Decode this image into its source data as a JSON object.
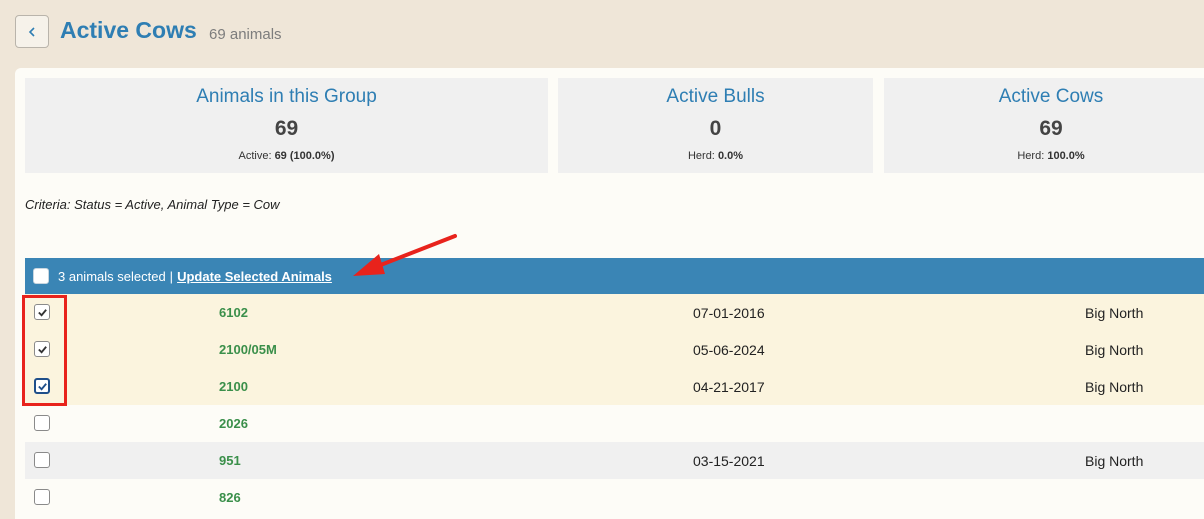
{
  "header": {
    "title": "Active Cows",
    "count": "69 animals"
  },
  "stats": [
    {
      "title": "Animals in this Group",
      "value": "69",
      "sub_label": "Active:",
      "sub_value": "69 (100.0%)"
    },
    {
      "title": "Active Bulls",
      "value": "0",
      "sub_label": "Herd:",
      "sub_value": "0.0%"
    },
    {
      "title": "Active Cows",
      "value": "69",
      "sub_label": "Herd:",
      "sub_value": "100.0%"
    }
  ],
  "criteria": "Criteria: Status = Active, Animal Type = Cow",
  "selection": {
    "text": "3 animals selected",
    "separator": "|",
    "link": "Update Selected Animals"
  },
  "rows": [
    {
      "id": "6102",
      "date": "07-01-2016",
      "location": "Big North",
      "checked": true
    },
    {
      "id": "2100/05M",
      "date": "05-06-2024",
      "location": "Big North",
      "checked": true
    },
    {
      "id": "2100",
      "date": "04-21-2017",
      "location": "Big North",
      "checked": true
    },
    {
      "id": "2026",
      "date": "",
      "location": "",
      "checked": false
    },
    {
      "id": "951",
      "date": "03-15-2021",
      "location": "Big North",
      "checked": false
    },
    {
      "id": "826",
      "date": "",
      "location": "",
      "checked": false
    }
  ],
  "colors": {
    "accent": "#2e7eb3",
    "selection_bar": "#3a85b5",
    "id_text": "#3a8f4a",
    "annotation": "#e8231c"
  }
}
